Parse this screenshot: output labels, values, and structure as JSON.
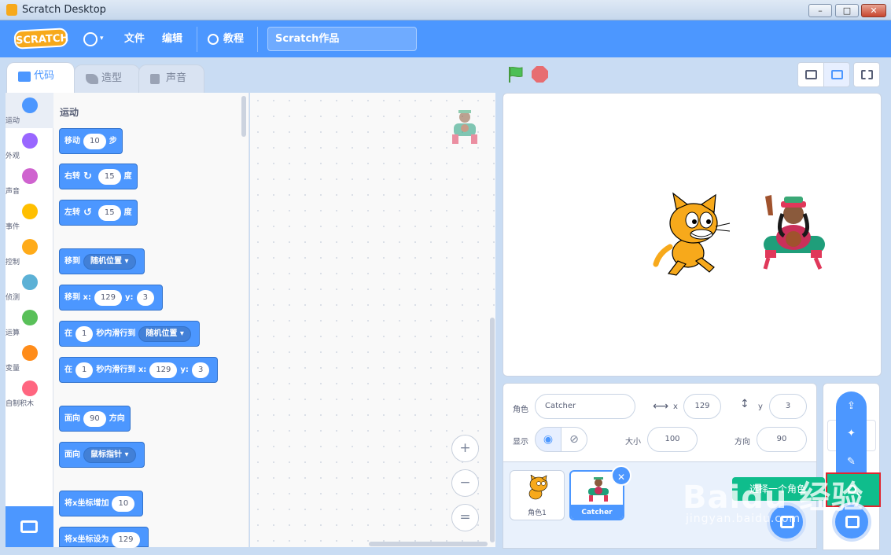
{
  "window": {
    "title": "Scratch Desktop",
    "min": "–",
    "max": "□",
    "close": "✕"
  },
  "menubar": {
    "logo": "SCRATCH",
    "globe_caret": "▾",
    "file": "文件",
    "edit": "编辑",
    "tutorials": "教程",
    "project_title": "Scratch作品"
  },
  "tabs": [
    {
      "label": "代码"
    },
    {
      "label": "造型"
    },
    {
      "label": "声音"
    }
  ],
  "categories": [
    {
      "label": "运动",
      "color": "#4c97ff"
    },
    {
      "label": "外观",
      "color": "#9966ff"
    },
    {
      "label": "声音",
      "color": "#cf63cf"
    },
    {
      "label": "事件",
      "color": "#ffbf00"
    },
    {
      "label": "控制",
      "color": "#ffab19"
    },
    {
      "label": "侦测",
      "color": "#5cb1d6"
    },
    {
      "label": "运算",
      "color": "#59c059"
    },
    {
      "label": "变量",
      "color": "#ff8c1a"
    },
    {
      "label": "自制积木",
      "color": "#ff6680"
    }
  ],
  "palette": {
    "section": "运动",
    "move": {
      "a": "移动",
      "n": "10",
      "b": "步"
    },
    "turn_right": {
      "a": "右转",
      "icon": "↻",
      "n": "15",
      "b": "度"
    },
    "turn_left": {
      "a": "左转",
      "icon": "↺",
      "n": "15",
      "b": "度"
    },
    "goto": {
      "a": "移到",
      "dd": "随机位置 ▾"
    },
    "goto_xy": {
      "a": "移到 x:",
      "x": "129",
      "b": "y:",
      "y": "3"
    },
    "glide": {
      "a": "在",
      "n": "1",
      "b": "秒内滑行到",
      "dd": "随机位置 ▾"
    },
    "glide_xy": {
      "a": "在",
      "n": "1",
      "b": "秒内滑行到 x:",
      "x": "129",
      "c": "y:",
      "y": "3"
    },
    "point_dir": {
      "a": "面向",
      "n": "90",
      "b": "方向"
    },
    "point_toward": {
      "a": "面向",
      "dd": "鼠标指针 ▾"
    },
    "change_x": {
      "a": "将x坐标增加",
      "n": "10"
    },
    "set_x": {
      "a": "将x坐标设为",
      "n": "129"
    }
  },
  "zoom": {
    "in": "+",
    "out": "−",
    "reset": "="
  },
  "sprite_info": {
    "sprite_label": "角色",
    "sprite_name": "Catcher",
    "x_label": "x",
    "x": "129",
    "y_label": "y",
    "y": "3",
    "show_label": "显示",
    "size_label": "大小",
    "size": "100",
    "direction_label": "方向",
    "direction": "90",
    "x_arrow": "⟷",
    "y_arrow": "↕",
    "eye": "◉",
    "eye_off": "⊘"
  },
  "sprites": [
    {
      "name": "角色1"
    },
    {
      "name": "Catcher"
    }
  ],
  "delete_icon": "✕",
  "fan": {
    "upload": "⇪",
    "surprise": "✦",
    "paint": "✎"
  },
  "tooltip": "选择一个角色",
  "watermark": {
    "main": "Baidu 经验",
    "sub": "jingyan.baidu.com"
  }
}
